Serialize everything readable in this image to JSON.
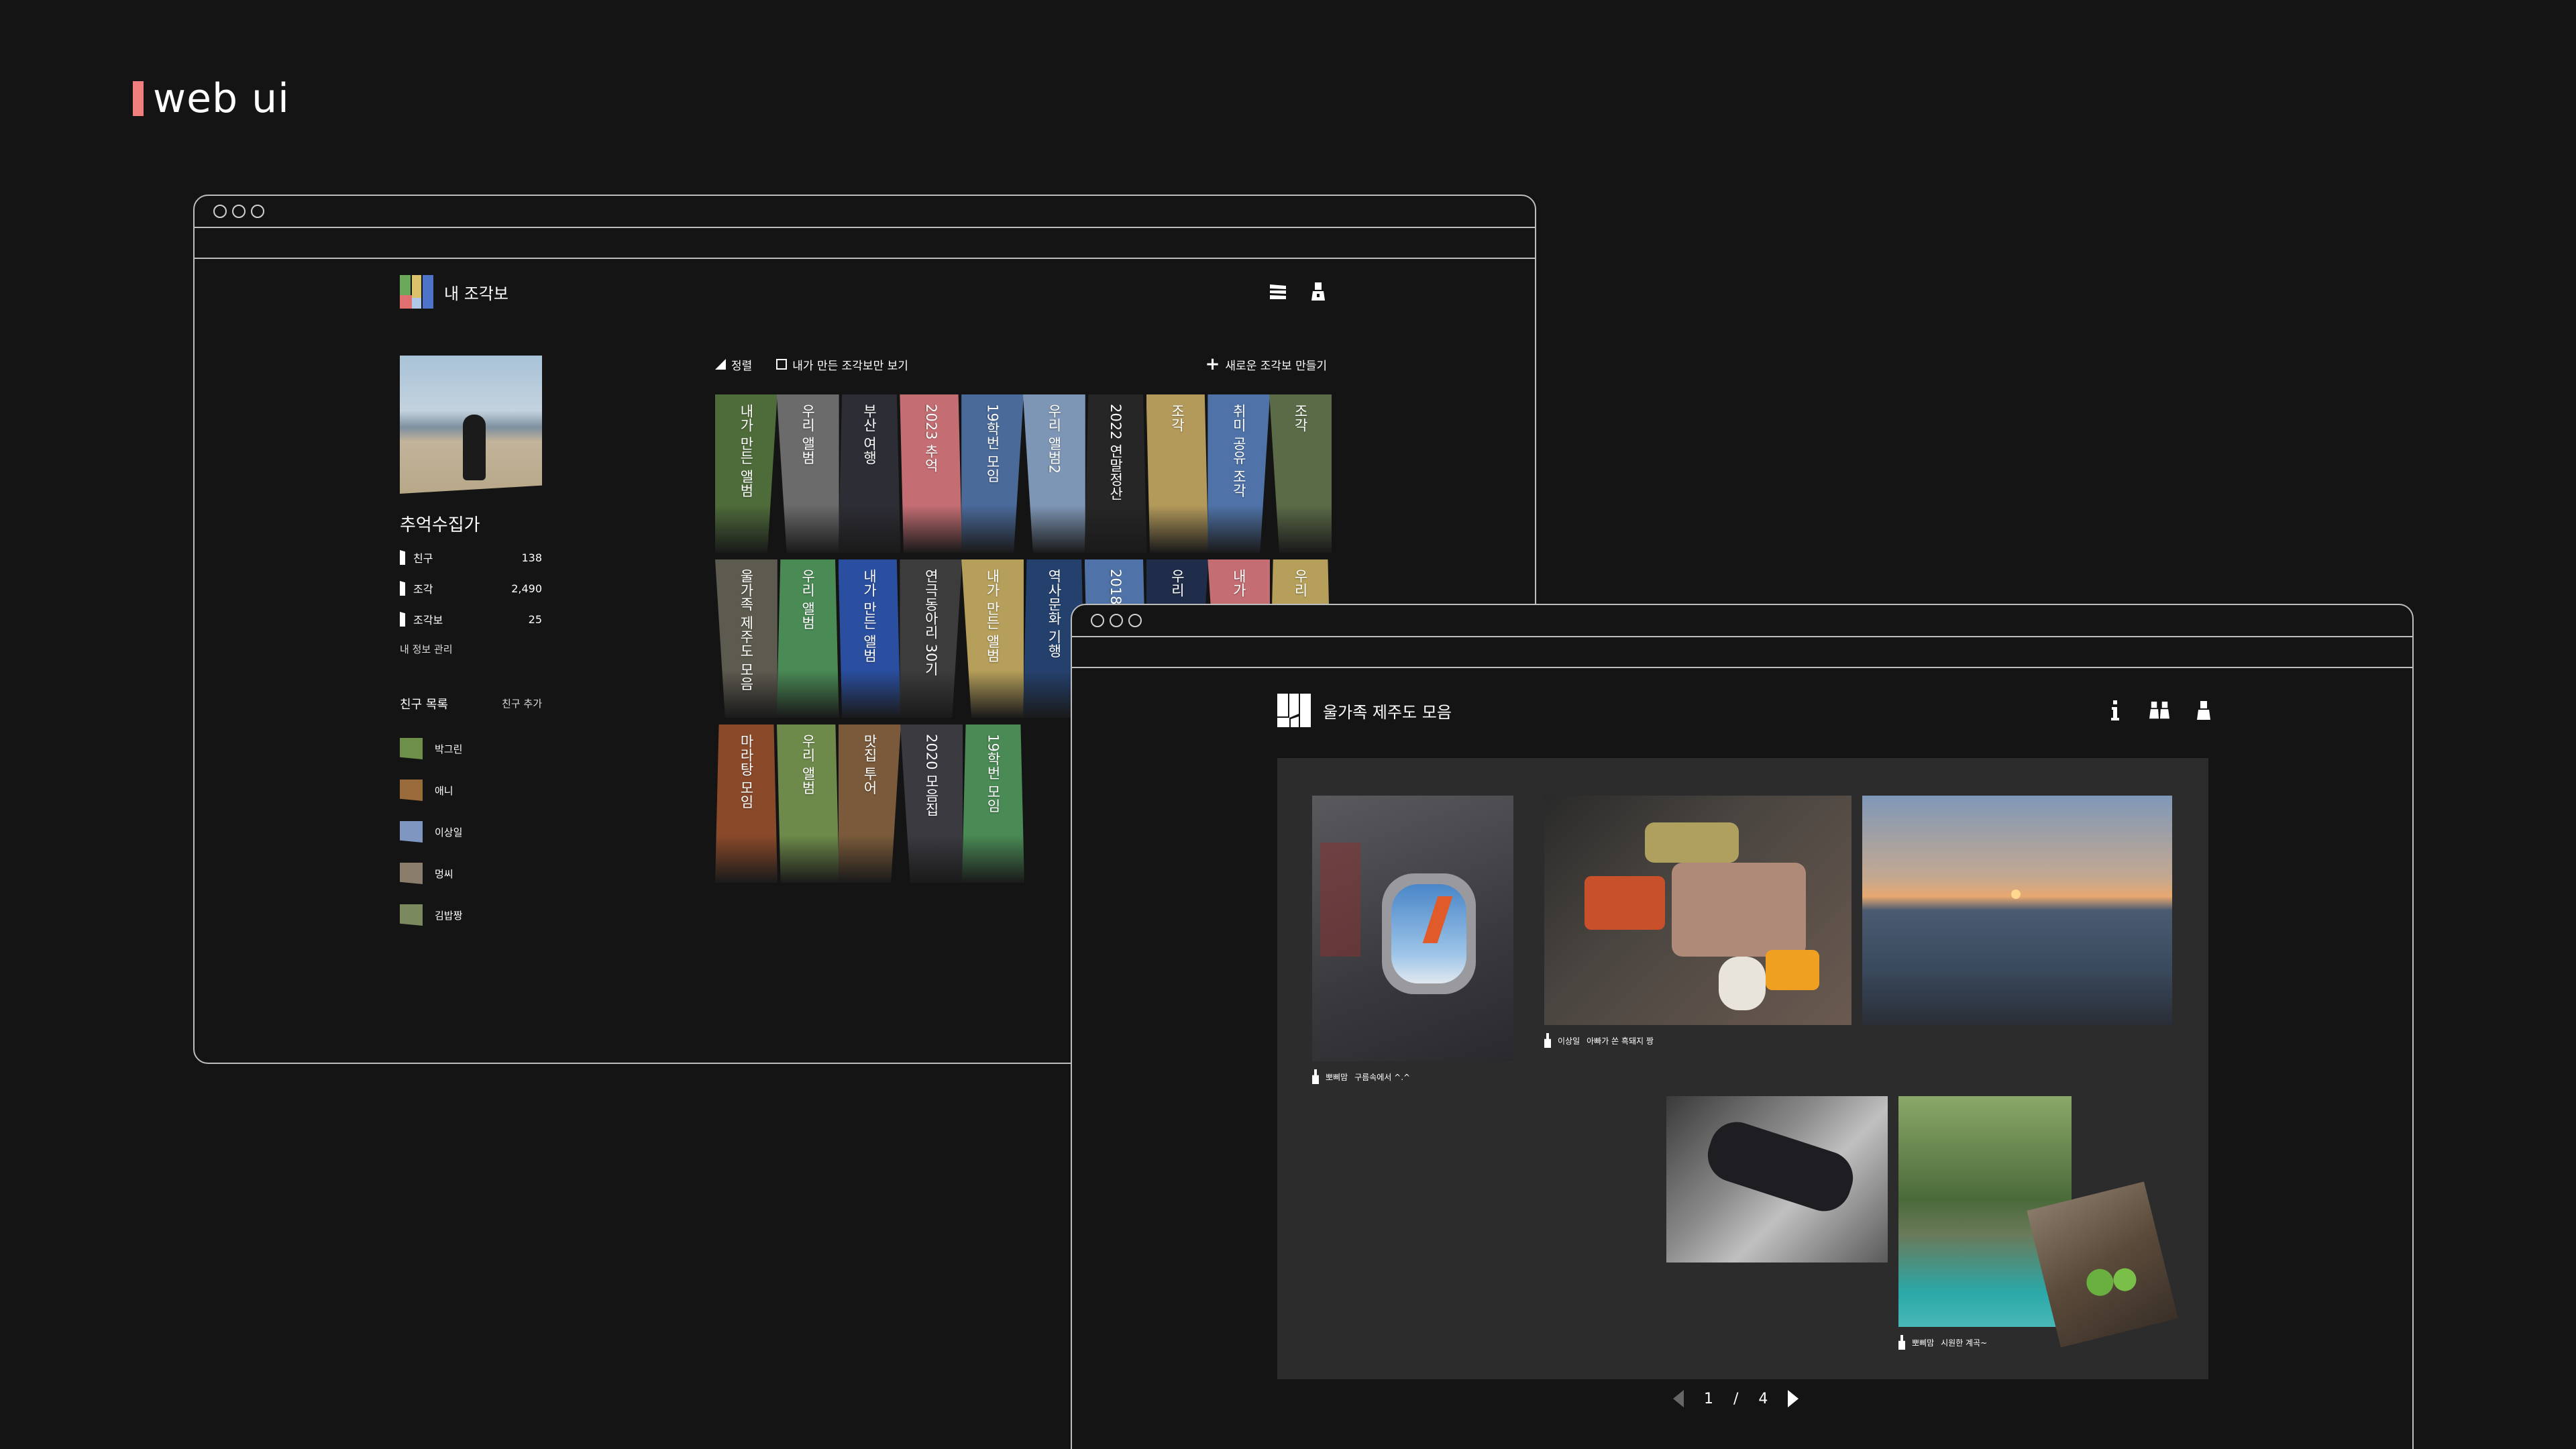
{
  "page_title": "web ui",
  "window1": {
    "app_name": "내 조각보",
    "profile": {
      "nickname": "추억수집가",
      "stats": [
        {
          "label": "친구",
          "value": "138"
        },
        {
          "label": "조각",
          "value": "2,490"
        },
        {
          "label": "조각보",
          "value": "25"
        }
      ],
      "manage_label": "내 정보 관리"
    },
    "friends": {
      "title": "친구 목록",
      "add_label": "친구 추가",
      "items": [
        {
          "name": "박그린",
          "color": "#6d8f4a"
        },
        {
          "name": "애니",
          "color": "#9a6b3a"
        },
        {
          "name": "이상일",
          "color": "#7f96c0"
        },
        {
          "name": "멍씨",
          "color": "#8a7d6b"
        },
        {
          "name": "김밥짱",
          "color": "#7b8a5e"
        }
      ]
    },
    "toolbar": {
      "sort_label": "정렬",
      "mine_only_label": "내가 만든 조각보만 보기",
      "new_label": "새로운 조각보 만들기"
    },
    "albums": [
      [
        {
          "title": "내가 만든 앨범",
          "color": "#4e6b3a"
        },
        {
          "title": "우리 앨범",
          "color": "#6b6b6b"
        },
        {
          "title": "부산 여행",
          "color": "#2d2d35"
        },
        {
          "title": "2023 추억",
          "color": "#c46e73"
        },
        {
          "title": "19학번 모임",
          "color": "#4a6a9a"
        },
        {
          "title": "우리 앨범2",
          "color": "#7e96b5"
        },
        {
          "title": "2022 연말정산",
          "color": "#262626"
        },
        {
          "title": "조각",
          "color": "#b39a5b"
        },
        {
          "title": "취미 공유 조각",
          "color": "#4f73a8"
        },
        {
          "title": "조각",
          "color": "#5b6b47"
        }
      ],
      [
        {
          "title": "울가족 제주도 모음",
          "color": "#5d5a4f"
        },
        {
          "title": "우리 앨범",
          "color": "#4a8a55"
        },
        {
          "title": "내가 만든 앨범",
          "color": "#2a4fa0"
        },
        {
          "title": "연극동아리 30기",
          "color": "#3c3c3c"
        },
        {
          "title": "내가 만든 앨범",
          "color": "#b59f5a"
        },
        {
          "title": "역사문화 기행",
          "color": "#24416e"
        },
        {
          "title": "2018",
          "color": "#4f73a8"
        },
        {
          "title": "우리",
          "color": "#1f2d4a"
        },
        {
          "title": "내가",
          "color": "#c46e73"
        },
        {
          "title": "우리",
          "color": "#b59f5a"
        }
      ],
      [
        {
          "title": "마라탕 모임",
          "color": "#8a4a2a"
        },
        {
          "title": "우리 앨범",
          "color": "#6e8a4a"
        },
        {
          "title": "맛집 투어",
          "color": "#7a5a3a"
        },
        {
          "title": "2020 모음집",
          "color": "#3a3a40"
        },
        {
          "title": "19학번 모임",
          "color": "#4a8a55"
        }
      ]
    ]
  },
  "window2": {
    "album_name": "울가족 제주도 모음",
    "photos": [
      {
        "author": "뽀삐맘",
        "caption": "구름속에서 ^.^"
      },
      {
        "author": "이상일",
        "caption": "아빠가 쏜 흑돼지 짱"
      },
      {
        "author": "뽀삐맘",
        "caption": "시원한 계곡~"
      }
    ],
    "pager": {
      "current": "1",
      "sep": "/",
      "total": "4"
    }
  },
  "colors": {
    "accent": "#f08080",
    "background": "#141414",
    "board": "#2c2c2c"
  },
  "icons": [
    "list-icon",
    "user-icon",
    "info-icon",
    "group-icon",
    "person-icon",
    "sort-icon",
    "plus-icon",
    "checkbox-icon",
    "pin-icon"
  ]
}
